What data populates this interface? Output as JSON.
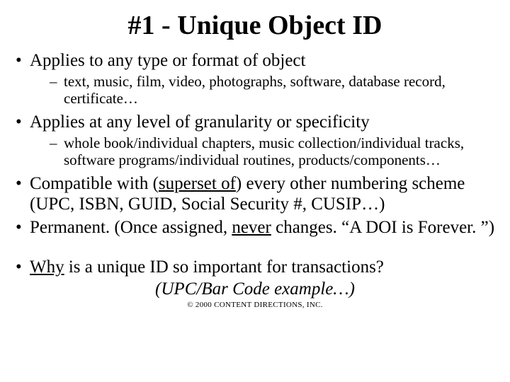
{
  "title": "#1 - Unique Object ID",
  "bullets": {
    "b1": "Applies to any type or format of object",
    "b1_sub": "text, music, film, video, photographs, software, database record, certificate…",
    "b2": "Applies at any level of granularity or specificity",
    "b2_sub": "whole book/individual chapters, music collection/individual tracks, software programs/individual routines, products/components…",
    "b3_pre": "Compatible with (",
    "b3_u": "superset of",
    "b3_post": ") every other numbering scheme (UPC, ISBN, GUID, Social Security #, CUSIP…)",
    "b4_pre": "Permanent.  (Once assigned, ",
    "b4_u": "never",
    "b4_post": " changes.  “A DOI is Forever. ”)",
    "b5_u": "Why",
    "b5_post": " is a unique ID so important for transactions?"
  },
  "example": "(UPC/Bar Code example…)",
  "copyright": "© 2000 CONTENT DIRECTIONS, INC."
}
